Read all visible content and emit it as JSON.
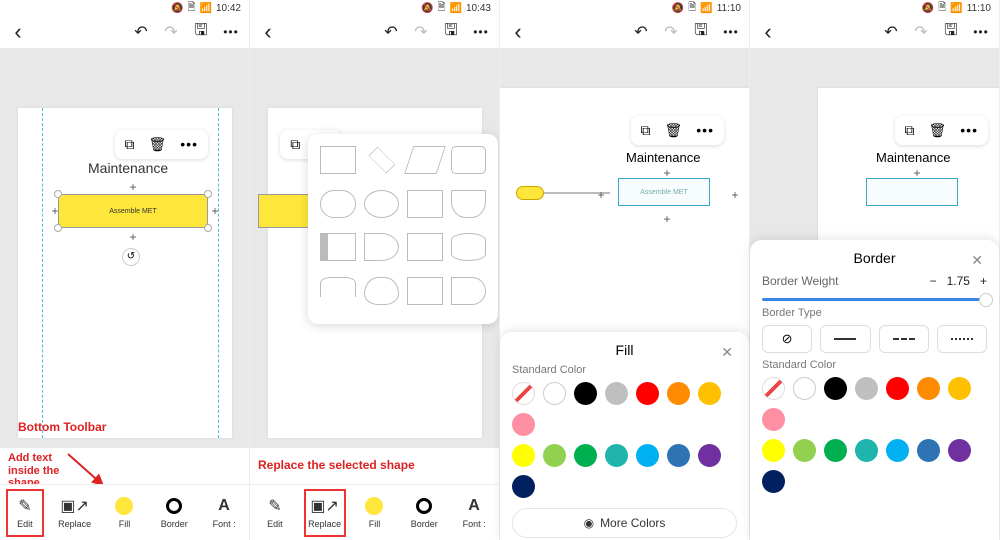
{
  "status": {
    "doc_icon": "🗎",
    "wifi": "📶",
    "bell": "🔕",
    "t1": "10:42",
    "t2": "10:43",
    "t3": "11:10",
    "t4": "11:10"
  },
  "top": {
    "back": "‹",
    "undo": "↶",
    "redo": "↷",
    "save": "🖫",
    "more": "•••"
  },
  "node": {
    "copy": "⧉",
    "trash": "🗑",
    "dots": "•••",
    "title": "Maintenance",
    "shape_text": "Assemble MET",
    "plus": "+",
    "reset": "↺"
  },
  "toolbar": {
    "edit": "Edit",
    "replace": "Replace",
    "fill": "Fill",
    "border": "Border",
    "font": "Font :"
  },
  "anno": {
    "bottom_toolbar": "Bottom Toolbar",
    "add_text": "Add text\ninside the\nshape",
    "replace": "Replace the selected shape"
  },
  "fill": {
    "title": "Fill",
    "standard": "Standard Color",
    "more": "More Colors",
    "colors_row1": [
      "none",
      "white",
      "#000000",
      "#bfbfbf",
      "#ff0000",
      "#ff8c00",
      "#ffc000",
      "#ff8fa3"
    ],
    "colors_row2": [
      "#ffff00",
      "#92d050",
      "#00b050",
      "#1fb5ad",
      "#00b0f0",
      "#2e74b5",
      "#7030a0",
      "#002060"
    ]
  },
  "border": {
    "title": "Border",
    "weight_label": "Border Weight",
    "weight": "1.75",
    "type_label": "Border Type",
    "standard": "Standard Color",
    "types": [
      "none",
      "solid",
      "dash",
      "dots"
    ],
    "colors_row1": [
      "none",
      "white",
      "#000000",
      "#bfbfbf",
      "#ff0000",
      "#ff8c00",
      "#ffc000",
      "#ff8fa3"
    ],
    "colors_row2": [
      "#ffff00",
      "#92d050",
      "#00b050",
      "#1fb5ad",
      "#00b0f0",
      "#2e74b5",
      "#7030a0",
      "#002060"
    ]
  }
}
